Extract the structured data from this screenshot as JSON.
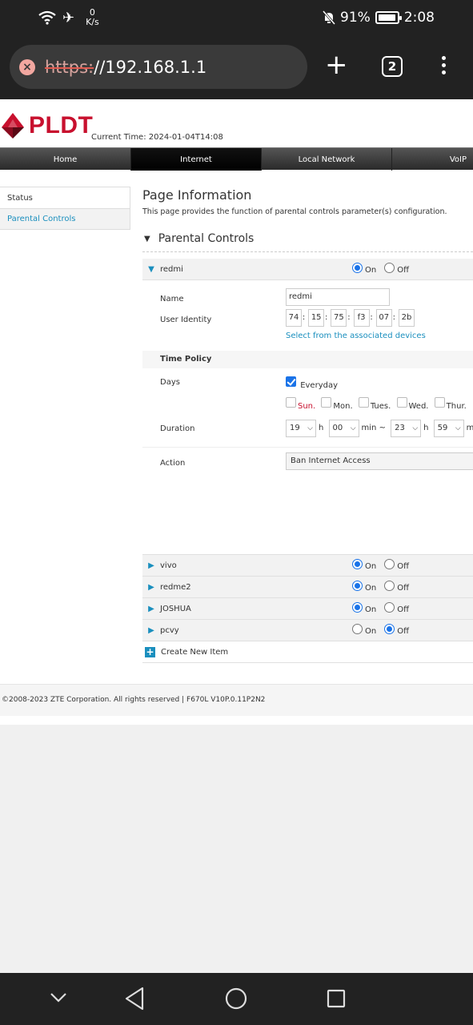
{
  "status_bar": {
    "speed_value": "0",
    "speed_unit": "K/s",
    "battery": "91%",
    "time": "2:08"
  },
  "browser": {
    "url_scheme": "https:",
    "url_rest": "//192.168.1.1",
    "tab_count": "2"
  },
  "header": {
    "logo": "PLDT",
    "current_time": "Current Time: 2024-01-04T14:08"
  },
  "nav": [
    "Home",
    "Internet",
    "Local Network",
    "VoIP"
  ],
  "sidebar": {
    "items": [
      "Status",
      "Parental Controls"
    ]
  },
  "main": {
    "title": "Page Information",
    "description": "This page provides the function of parental controls parameter(s) configuration.",
    "section": "Parental Controls",
    "on_label": "On",
    "off_label": "Off",
    "rules": [
      {
        "name": "redmi",
        "state": "On"
      },
      {
        "name": "vivo",
        "state": "On"
      },
      {
        "name": "redme2",
        "state": "On"
      },
      {
        "name": "JOSHUA",
        "state": "On"
      },
      {
        "name": "pcvy",
        "state": "Off"
      }
    ],
    "detail": {
      "name_label": "Name",
      "name_value": "redmi",
      "identity_label": "User Identity",
      "mac": [
        "74",
        "15",
        "75",
        "f3",
        "07",
        "2b"
      ],
      "select_link": "Select from the associated devices",
      "time_policy": "Time Policy",
      "days_label": "Days",
      "everyday": "Everyday",
      "days": [
        "Sun.",
        "Mon.",
        "Tues.",
        "Wed.",
        "Thur."
      ],
      "duration_label": "Duration",
      "start_h": "19",
      "start_m": "00",
      "end_h": "23",
      "end_m": "59",
      "unit_h": "h",
      "unit_min_to": "min ~",
      "unit_min": "min",
      "action_label": "Action",
      "action_value": "Ban Internet Access"
    },
    "create_label": "Create New Item"
  },
  "footer": {
    "text": "©2008-2023 ZTE Corporation. All rights reserved  |   F670L V10P.0.11P2N2"
  },
  "colors": {
    "brand_red": "#c8102e",
    "link_blue": "#1a8fbe",
    "radio_blue": "#1a73e8"
  }
}
